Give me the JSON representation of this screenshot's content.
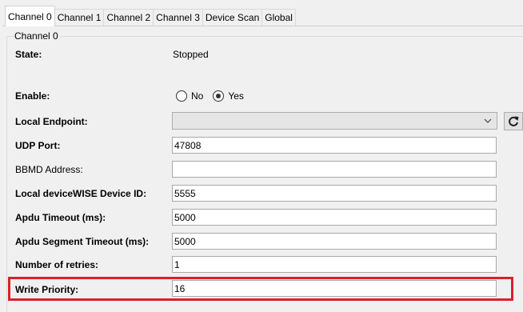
{
  "tabs": [
    {
      "label": "Channel 0",
      "active": true
    },
    {
      "label": "Channel 1",
      "active": false
    },
    {
      "label": "Channel 2",
      "active": false
    },
    {
      "label": "Channel 3",
      "active": false
    },
    {
      "label": "Device Scan",
      "active": false
    },
    {
      "label": "Global",
      "active": false
    }
  ],
  "group": {
    "title": "Channel 0"
  },
  "state": {
    "label": "State:",
    "value": "Stopped"
  },
  "enable": {
    "label": "Enable:",
    "options": [
      {
        "label": "No",
        "checked": false
      },
      {
        "label": "Yes",
        "checked": true
      }
    ]
  },
  "local_endpoint": {
    "label": "Local Endpoint:",
    "value": "",
    "refresh_icon": "refresh-icon"
  },
  "udp_port": {
    "label": "UDP Port:",
    "value": "47808"
  },
  "bbmd_address": {
    "label": "BBMD Address:",
    "value": ""
  },
  "device_id": {
    "label": "Local deviceWISE Device ID:",
    "value": "5555"
  },
  "apdu_timeout": {
    "label": "Apdu Timeout (ms):",
    "value": "5000"
  },
  "apdu_segment_timeout": {
    "label": "Apdu Segment Timeout (ms):",
    "value": "5000"
  },
  "retries": {
    "label": "Number of retries:",
    "value": "1"
  },
  "write_priority": {
    "label": "Write Priority:",
    "value": "16"
  },
  "colors": {
    "highlight_border": "#d8222a",
    "background": "#f0f0f0"
  }
}
